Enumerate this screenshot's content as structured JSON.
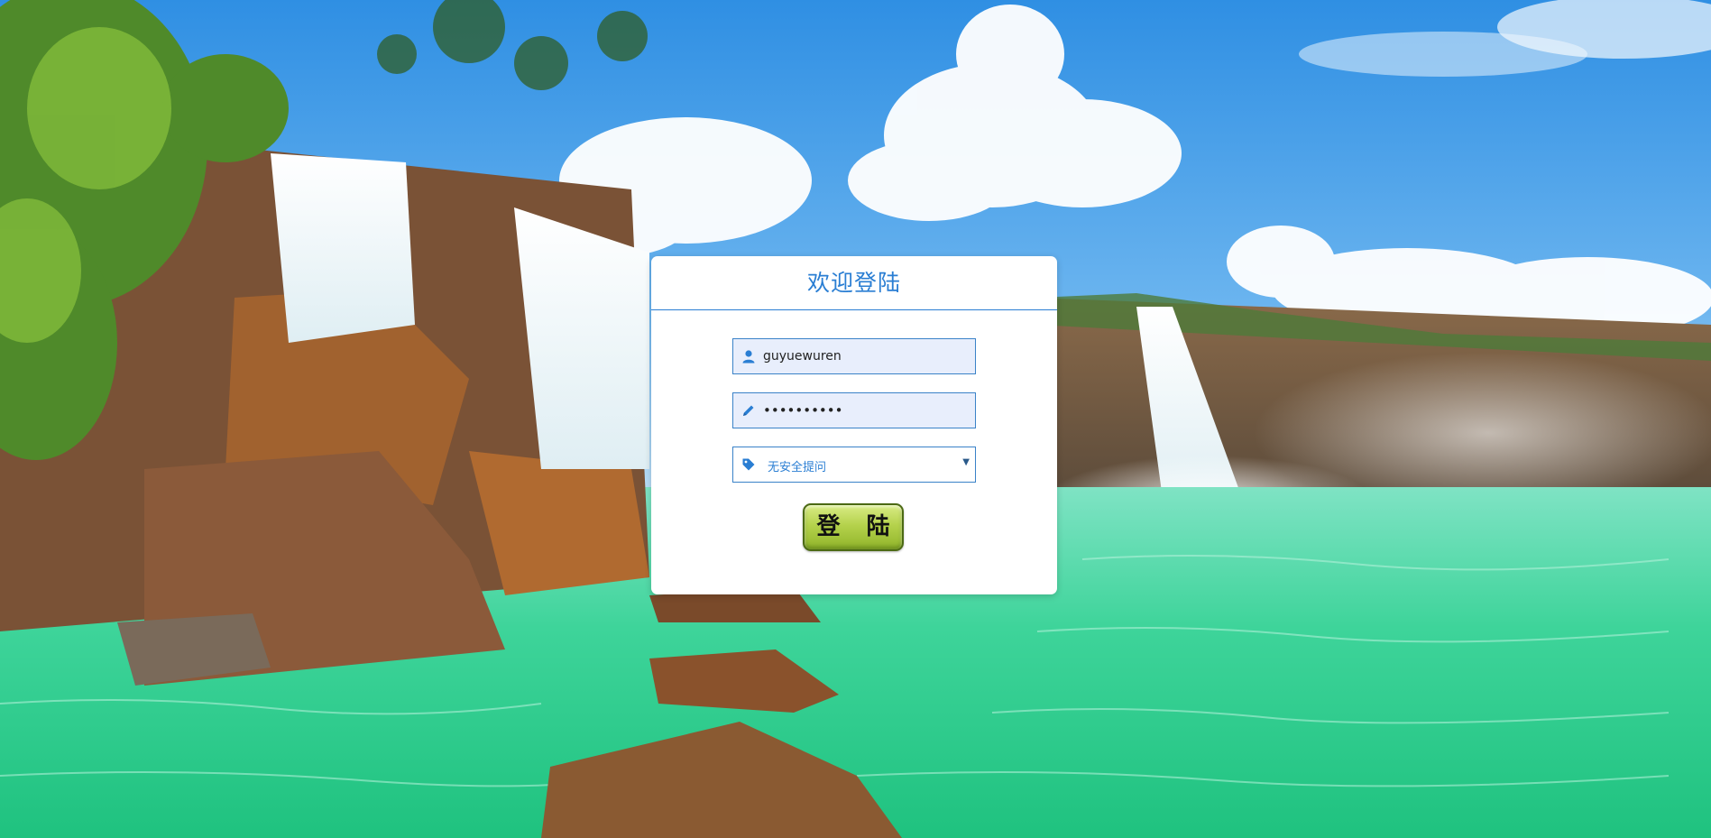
{
  "login": {
    "title": "欢迎登陆",
    "username": {
      "value": "guyuewuren",
      "icon": "user-icon"
    },
    "password": {
      "masked_value": "••••••••••",
      "icon": "pencil-icon"
    },
    "security_question": {
      "selected": "无安全提问",
      "icon": "tag-icon"
    },
    "submit_label": "登 陆"
  },
  "colors": {
    "accent": "#2a7ed3",
    "panel_background": "#ffffff",
    "button_green": "#b5d24c"
  }
}
